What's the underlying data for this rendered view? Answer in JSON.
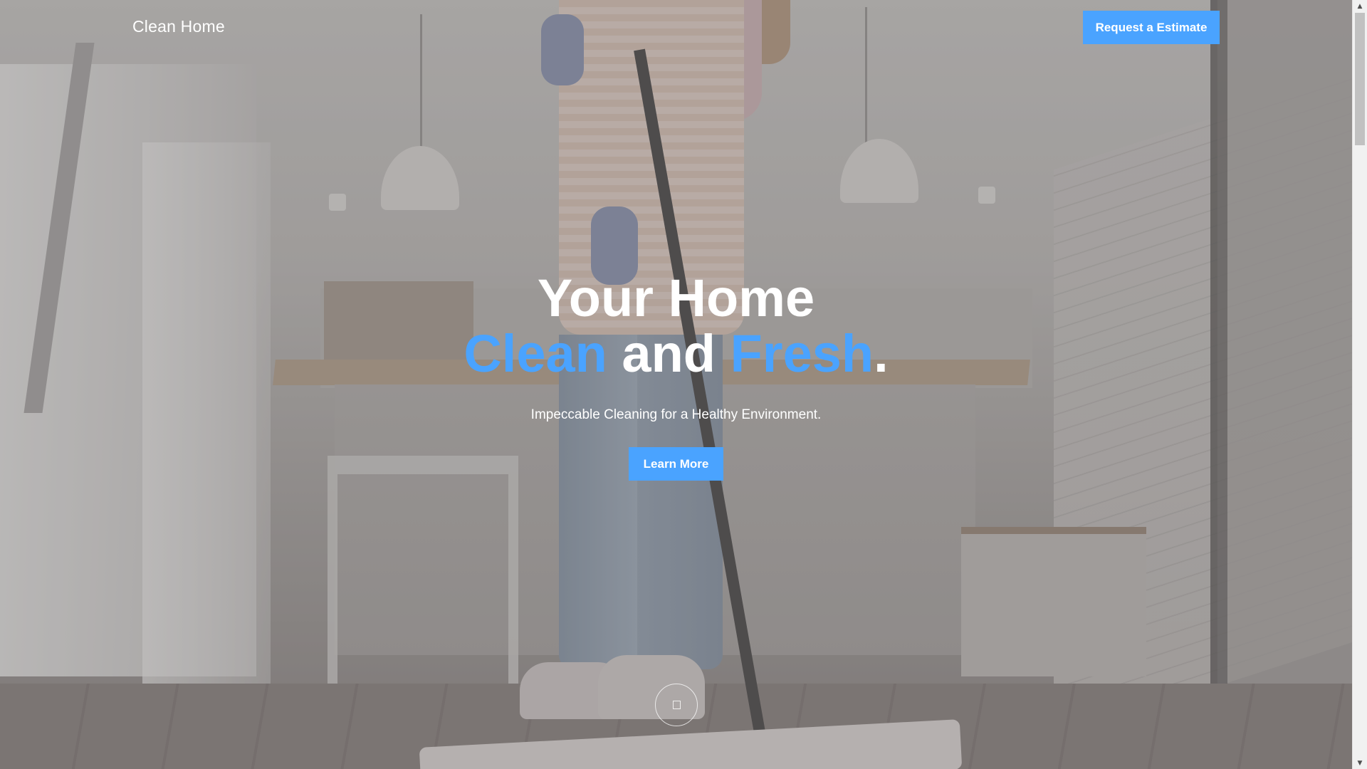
{
  "header": {
    "brand": "Clean Home",
    "cta_label": "Request a Estimate"
  },
  "hero": {
    "title_line1": "Your Home",
    "title_word_clean": "Clean",
    "title_word_and": " and ",
    "title_word_fresh": "Fresh",
    "title_period": ".",
    "subtitle": "Impeccable Cleaning for a Healthy Environment.",
    "button_label": "Learn More"
  },
  "scroll_indicator": {
    "icon": "square-glyph-icon"
  },
  "scrollbar": {
    "up_arrow": "▲",
    "down_arrow": "▼",
    "position": 0.0
  },
  "colors": {
    "accent": "#4aa3ff",
    "text": "#ffffff",
    "overlay": "rgba(80,78,78,0.28)"
  }
}
